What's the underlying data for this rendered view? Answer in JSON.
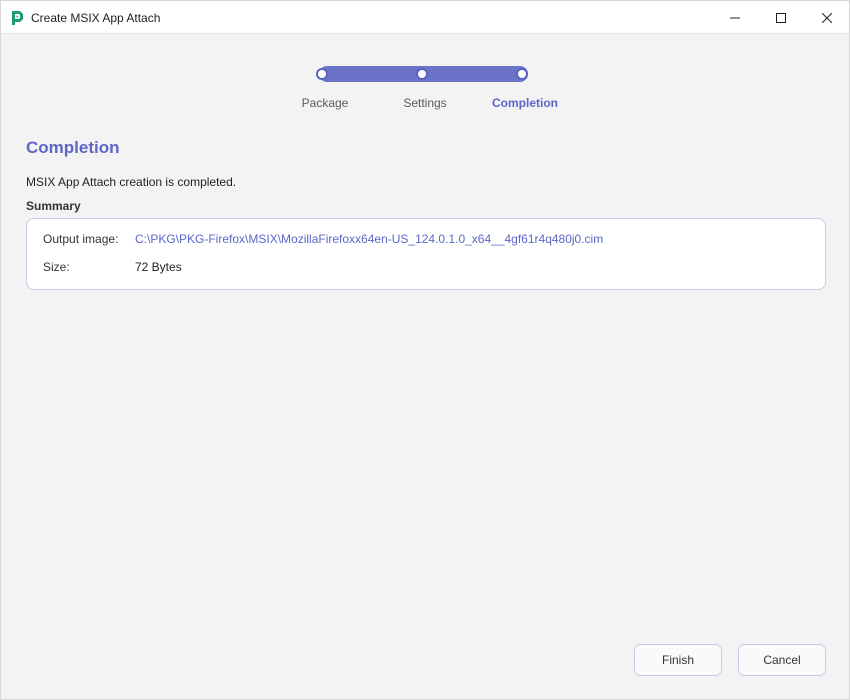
{
  "window": {
    "title": "Create MSIX App Attach",
    "controls": [
      "minimize-icon",
      "maximize-icon",
      "close-icon"
    ],
    "accent_color": "#5c66c8"
  },
  "stepper": {
    "steps": [
      {
        "label": "Package",
        "state": "done"
      },
      {
        "label": "Settings",
        "state": "done"
      },
      {
        "label": "Completion",
        "state": "active"
      }
    ]
  },
  "main": {
    "heading": "Completion",
    "description": "MSIX App Attach creation is completed.",
    "summary_label": "Summary",
    "summary": {
      "output_image_label": "Output image:",
      "output_image_value": "C:\\PKG\\PKG-Firefox\\MSIX\\MozillaFirefoxx64en-US_124.0.1.0_x64__4gf61r4q480j0.cim",
      "size_label": "Size:",
      "size_value": "72 Bytes"
    }
  },
  "footer": {
    "finish_label": "Finish",
    "cancel_label": "Cancel"
  }
}
